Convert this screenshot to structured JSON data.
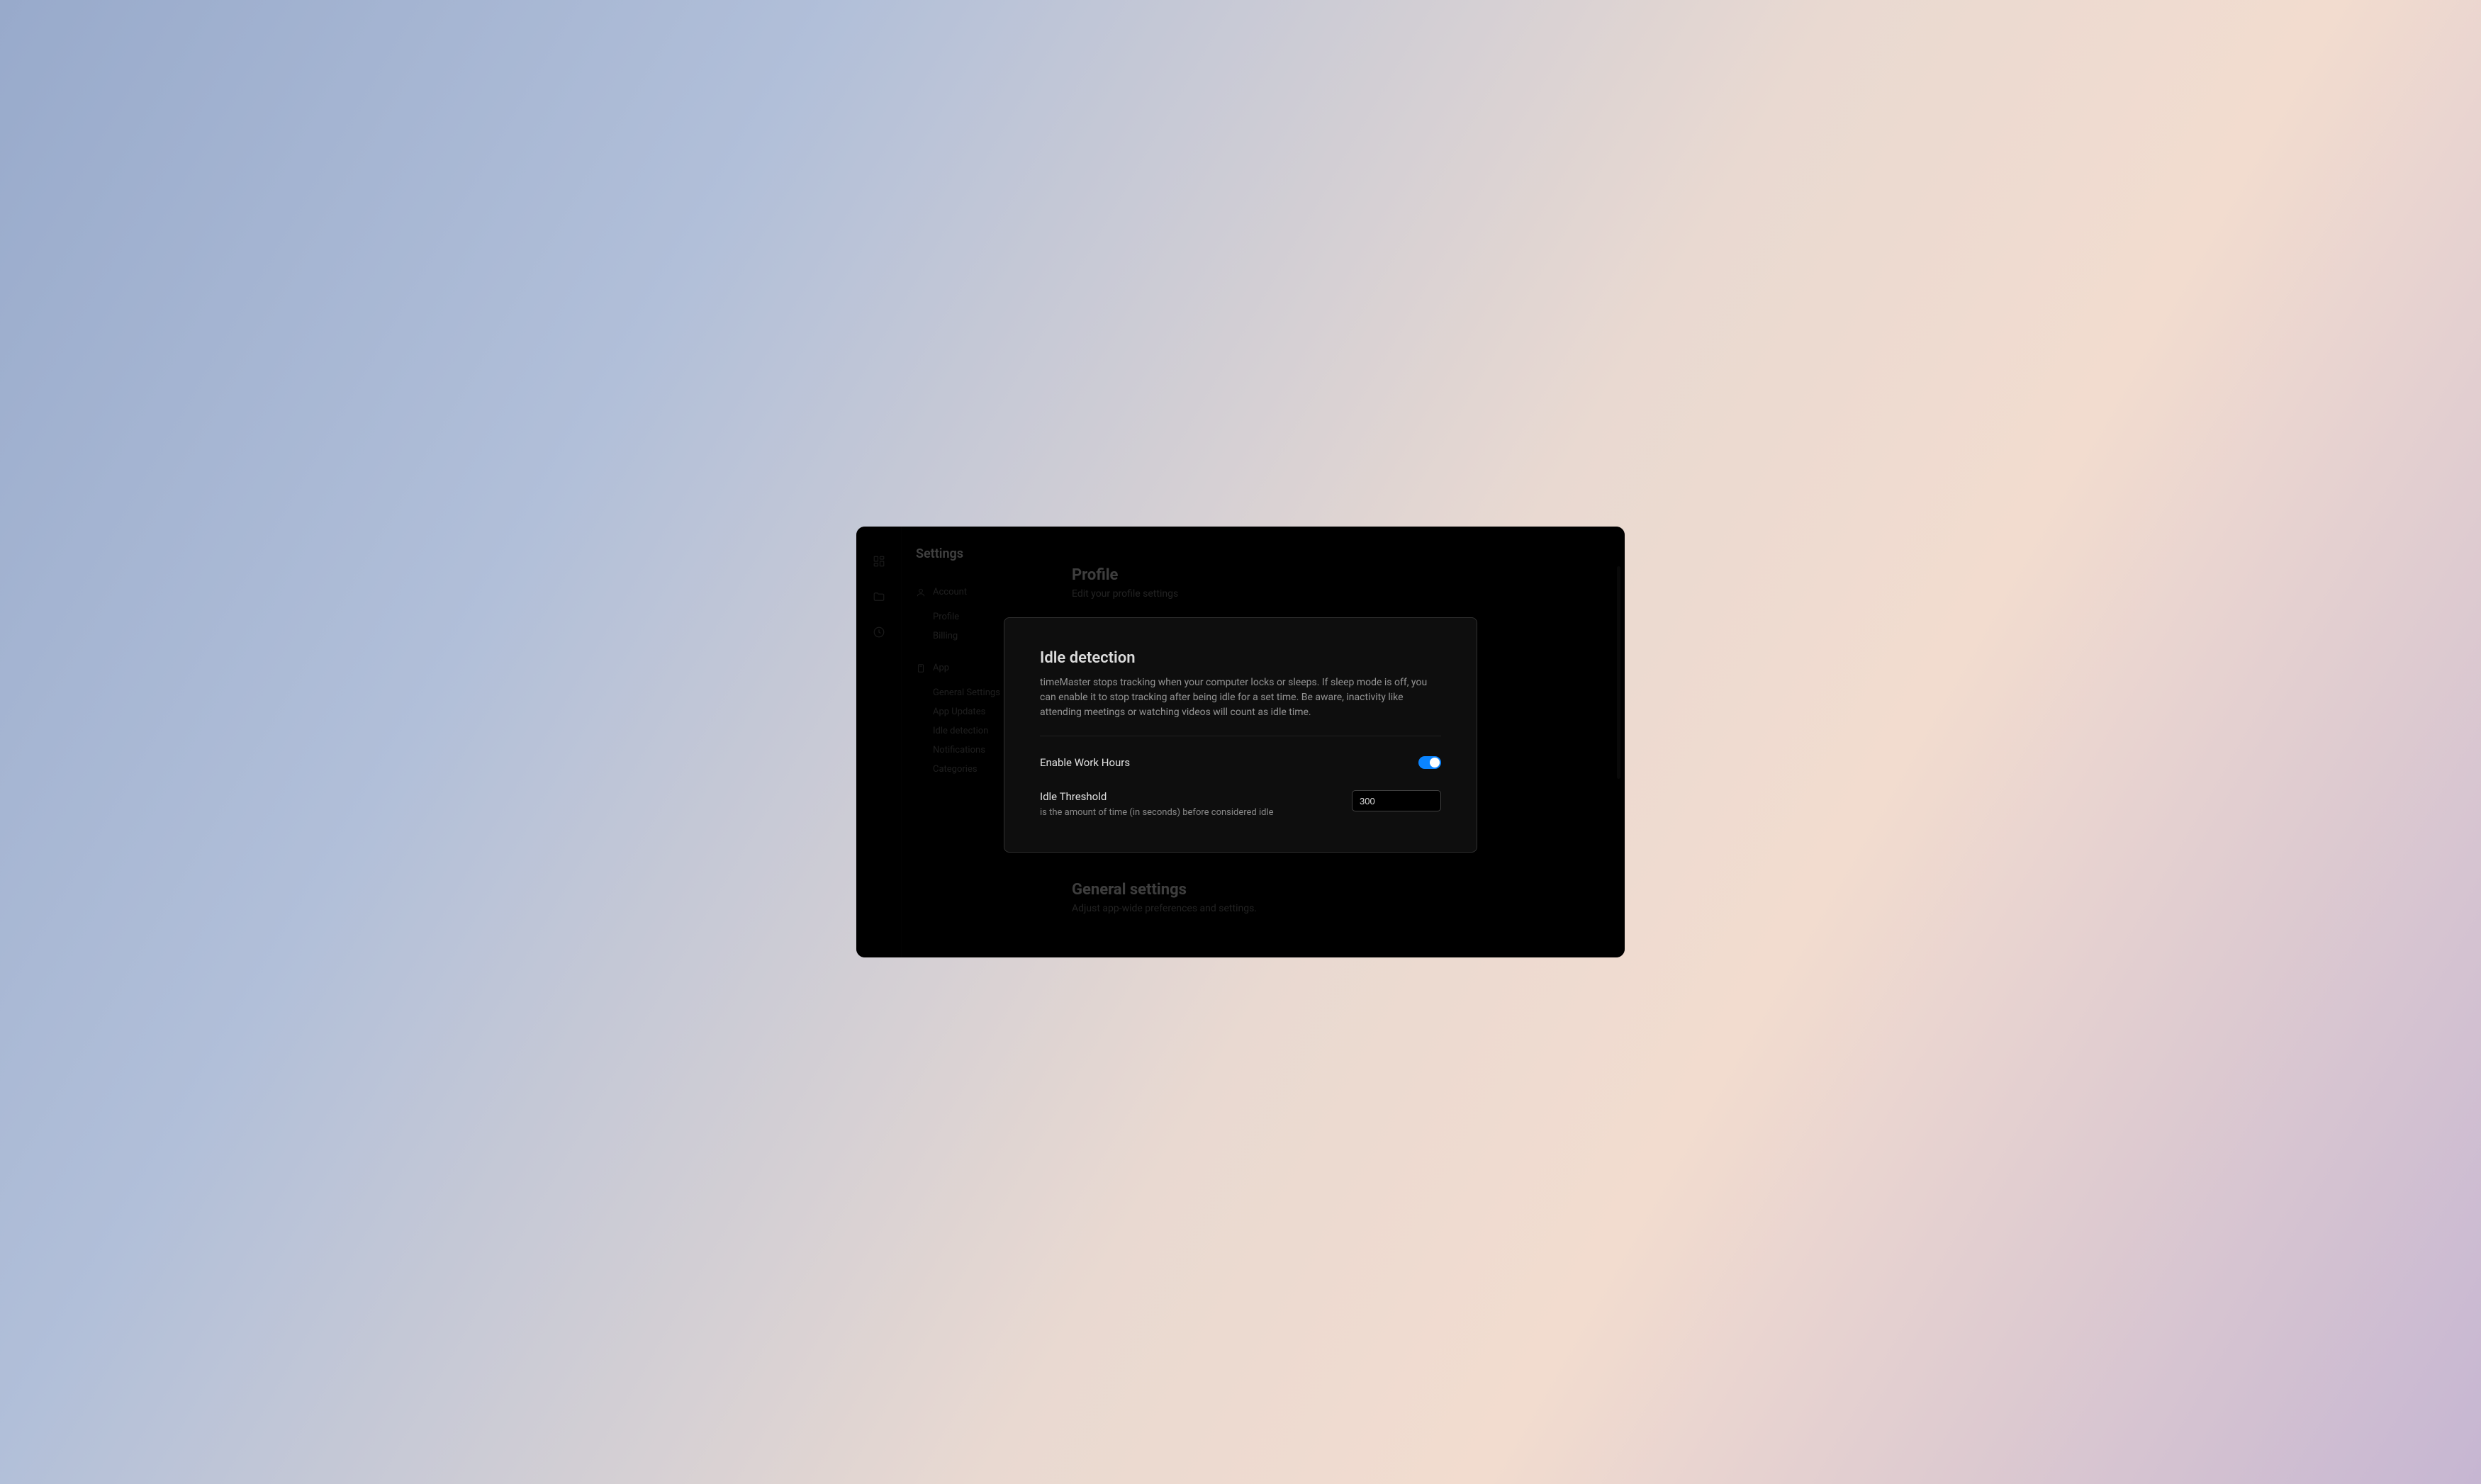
{
  "page_title": "Settings",
  "rail": {
    "icons": [
      "dashboard-icon",
      "folder-icon",
      "clock-icon"
    ]
  },
  "nav": {
    "sections": [
      {
        "icon": "user-icon",
        "label": "Account",
        "items": [
          "Profile",
          "Billing"
        ]
      },
      {
        "icon": "app-icon",
        "label": "App",
        "items": [
          "General Settings",
          "App Updates",
          "Idle detection",
          "Notifications",
          "Categories"
        ]
      }
    ]
  },
  "background": {
    "profile_title": "Profile",
    "profile_sub": "Edit your profile settings",
    "general_title": "General settings",
    "general_sub": "Adjust app-wide preferences and settings."
  },
  "modal": {
    "title": "Idle detection",
    "description": "timeMaster stops tracking when your computer locks or sleeps. If sleep mode is off, you can enable it to stop tracking after being idle for a set time. Be aware, inactivity like attending meetings or watching videos will count as idle time.",
    "enable_label": "Enable Work Hours",
    "enable_value": true,
    "threshold_label": "Idle Threshold",
    "threshold_sub": "is the amount of time (in seconds) before considered idle",
    "threshold_value": "300"
  },
  "colors": {
    "accent": "#0a84ff"
  }
}
